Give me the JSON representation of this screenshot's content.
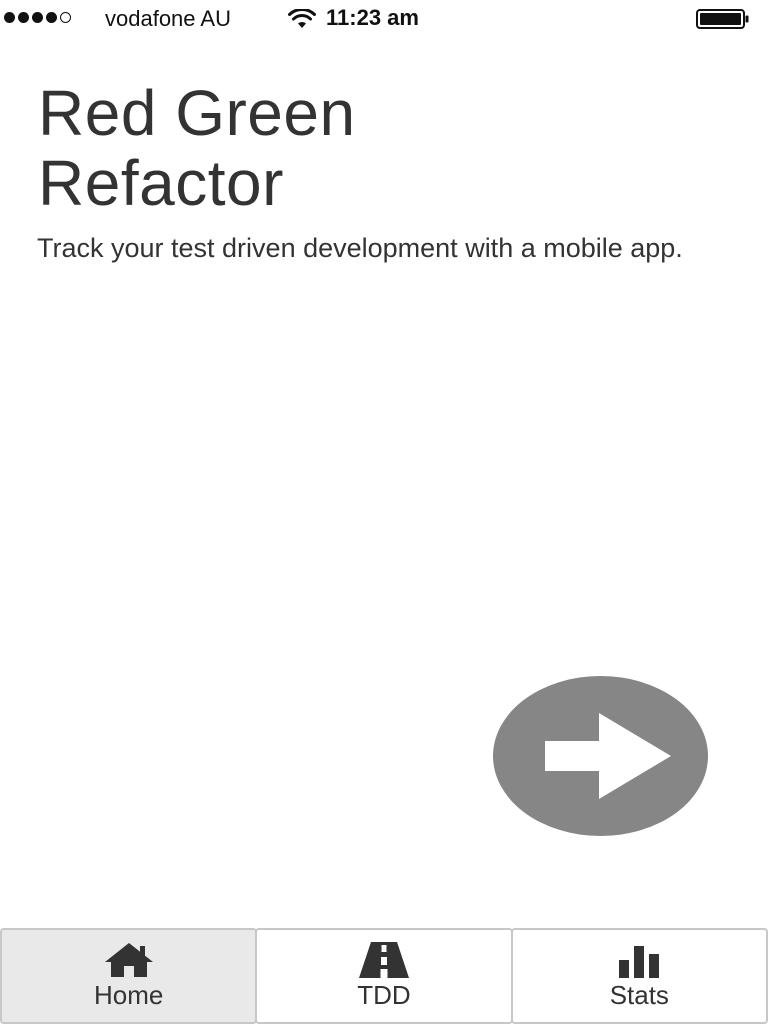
{
  "status_bar": {
    "carrier": "vodafone AU",
    "time": "11:23 am",
    "signal_bars_filled": 4,
    "signal_bars_total": 5,
    "battery_level": 1.0
  },
  "main": {
    "title_line1": "Red Green",
    "title_line2": "Refactor",
    "subtitle": "Track your test driven development with a mobile app."
  },
  "next_button": {
    "icon": "arrow-right-icon",
    "color": "#868686"
  },
  "tab_bar": {
    "tabs": [
      {
        "label": "Home",
        "icon": "home-icon",
        "active": true
      },
      {
        "label": "TDD",
        "icon": "road-icon",
        "active": false
      },
      {
        "label": "Stats",
        "icon": "bar-chart-icon",
        "active": false
      }
    ]
  }
}
